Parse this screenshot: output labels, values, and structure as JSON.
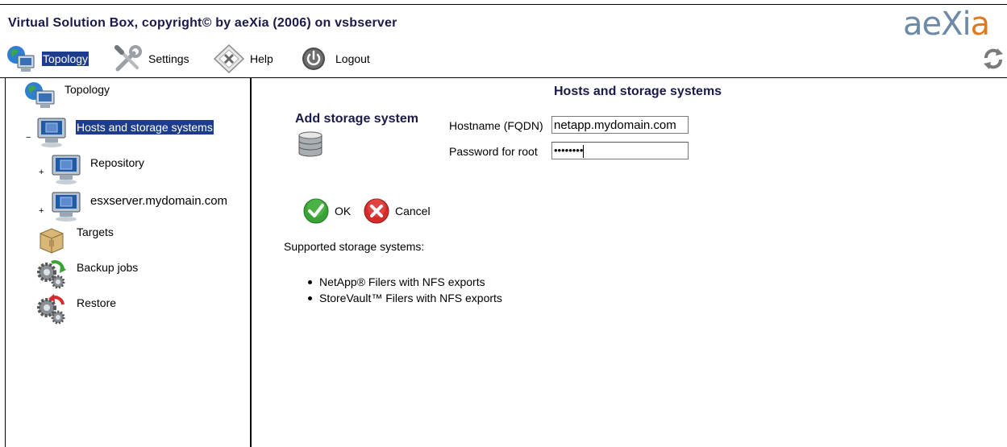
{
  "app": {
    "title": "Virtual Solution Box, copyright© by aeXia (2006) on vsbserver",
    "logo_main": "aeXi",
    "logo_end": "a"
  },
  "toolbar": {
    "topology_label": "Topology",
    "settings_label": "Settings",
    "help_label": "Help",
    "logout_label": "Logout"
  },
  "tree": {
    "topology": "Topology",
    "hosts_storage": "Hosts and storage systems",
    "repository": "Repository",
    "esxserver": "esxserver.mydomain.com",
    "targets": "Targets",
    "backup_jobs": "Backup jobs",
    "restore": "Restore"
  },
  "main": {
    "heading": "Hosts and storage systems",
    "add_title": "Add storage system",
    "hostname_label": "Hostname (FQDN)",
    "hostname_value": "netapp.mydomain.com",
    "password_label": "Password for root",
    "password_value": "••••••••",
    "ok_label": "OK",
    "cancel_label": "Cancel",
    "supported_label": "Supported storage systems:",
    "supported_items": [
      "NetApp® Filers with NFS exports",
      "StoreVault™ Filers with NFS exports"
    ]
  },
  "colors": {
    "selected_bg": "#1e3c8c",
    "heading": "#1a1a4a",
    "ok_green": "#3aa335",
    "cancel_red": "#d52b2b",
    "logo": "#6c8aa8"
  }
}
